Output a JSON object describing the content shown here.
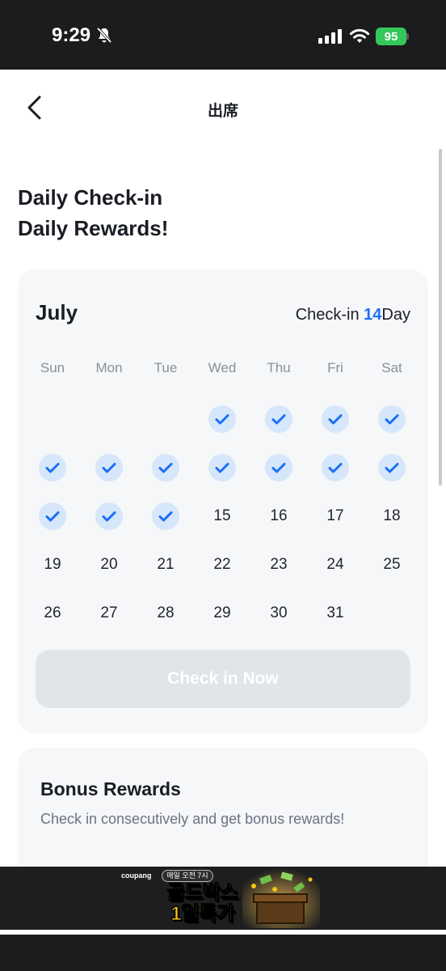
{
  "status_bar": {
    "time": "9:29",
    "battery": "95",
    "icons": [
      "bell-slash-icon",
      "signal-icon",
      "wifi-icon",
      "battery-icon"
    ]
  },
  "header": {
    "title": "出席",
    "back_icon": "chevron-left-icon"
  },
  "headline": {
    "line1": "Daily Check-in",
    "line2": "Daily Rewards!"
  },
  "calendar": {
    "month": "July",
    "checkin_prefix": "Check-in ",
    "checkin_days": "14",
    "checkin_suffix": "Day",
    "weekdays": [
      "Sun",
      "Mon",
      "Tue",
      "Wed",
      "Thu",
      "Fri",
      "Sat"
    ],
    "first_weekday_index": 3,
    "days_in_month": 31,
    "checked_days": 14,
    "check_icon": "checkmark-icon",
    "button_label": "Check in Now"
  },
  "bonus": {
    "title": "Bonus Rewards",
    "description": "Check in consecutively and get bonus rewards!"
  },
  "ad": {
    "brand": "coupang",
    "subtitle": "매일 오전 7시",
    "headline_line1": "골드박스",
    "headline_line2": "1일특가"
  },
  "colors": {
    "accent": "#1b6ff5",
    "check_bg": "#d6e6fb",
    "card_bg": "#f6f7f9",
    "button_disabled": "#e1e4e8",
    "status_green": "#34c759",
    "ad_gold": "#f5c518"
  }
}
